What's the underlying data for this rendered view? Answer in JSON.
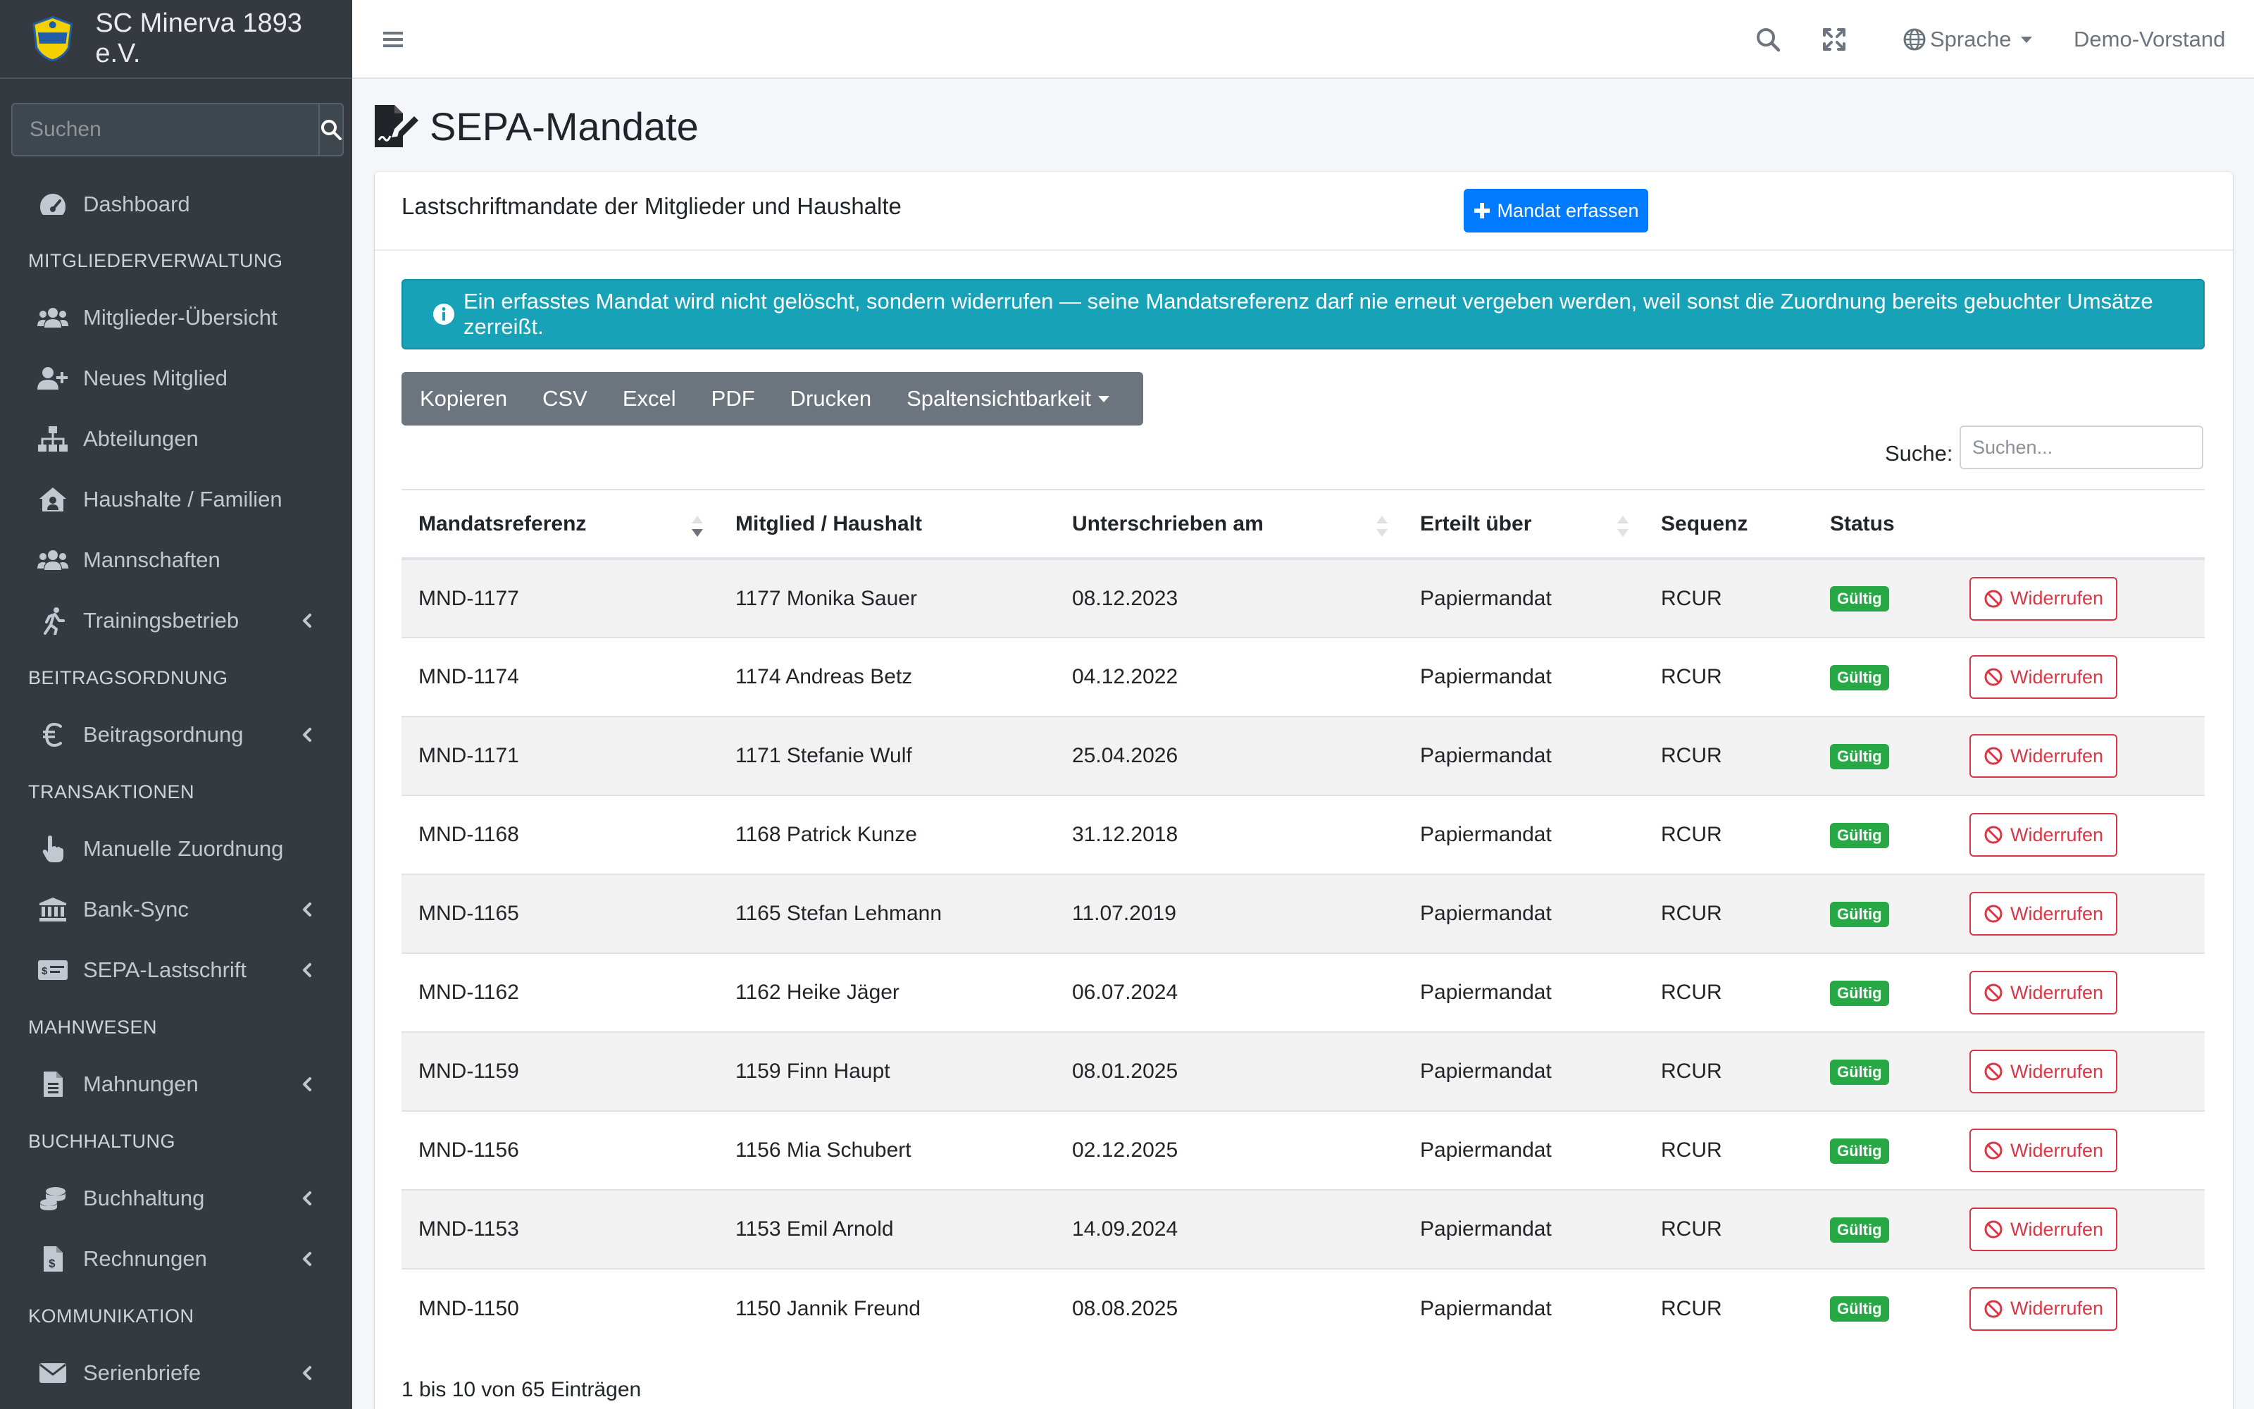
{
  "brand": {
    "name": "SC Minerva 1893 e.V."
  },
  "sidebar": {
    "search_placeholder": "Suchen",
    "dashboard": "Dashboard",
    "sections": [
      "MITGLIEDERVERWALTUNG",
      "BEITRAGSORDNUNG",
      "TRANSAKTIONEN",
      "MAHNWESEN",
      "BUCHHALTUNG",
      "KOMMUNIKATION"
    ],
    "items": {
      "mitglieder_uebersicht": "Mitglieder-Übersicht",
      "neues_mitglied": "Neues Mitglied",
      "abteilungen": "Abteilungen",
      "haushalte": "Haushalte / Familien",
      "mannschaften": "Mannschaften",
      "trainingsbetrieb": "Trainingsbetrieb",
      "beitragsordnung": "Beitragsordnung",
      "manuelle_zuordnung": "Manuelle Zuordnung",
      "bank_sync": "Bank-Sync",
      "sepa_lastschrift": "SEPA-Lastschrift",
      "mahnungen": "Mahnungen",
      "buchhaltung": "Buchhaltung",
      "rechnungen": "Rechnungen",
      "serienbriefe": "Serienbriefe"
    }
  },
  "topbar": {
    "language": "Sprache",
    "user": "Demo-Vorstand"
  },
  "page": {
    "title": "SEPA-Mandate"
  },
  "card": {
    "title": "Lastschriftmandate der Mitglieder und Haushalte",
    "add_button": "Mandat erfassen",
    "alert": "Ein erfasstes Mandat wird nicht gelöscht, sondern widerrufen — seine Mandatsreferenz darf nie erneut vergeben werden, weil sonst die Zuordnung bereits gebuchter Umsätze zerreißt.",
    "export_buttons": [
      "Kopieren",
      "CSV",
      "Excel",
      "PDF",
      "Drucken"
    ],
    "column_visibility": "Spaltensichtbarkeit",
    "search_label": "Suche:",
    "search_placeholder": "Suchen...",
    "columns": [
      "Mandatsreferenz",
      "Mitglied / Haushalt",
      "Unterschrieben am",
      "Erteilt über",
      "Sequenz",
      "Status"
    ],
    "rows": [
      {
        "ref": "MND-1177",
        "member": "1177 Monika Sauer",
        "signed": "08.12.2023",
        "via": "Papiermandat",
        "seq": "RCUR",
        "status": "Gültig",
        "action": "Widerrufen"
      },
      {
        "ref": "MND-1174",
        "member": "1174 Andreas Betz",
        "signed": "04.12.2022",
        "via": "Papiermandat",
        "seq": "RCUR",
        "status": "Gültig",
        "action": "Widerrufen"
      },
      {
        "ref": "MND-1171",
        "member": "1171 Stefanie Wulf",
        "signed": "25.04.2026",
        "via": "Papiermandat",
        "seq": "RCUR",
        "status": "Gültig",
        "action": "Widerrufen"
      },
      {
        "ref": "MND-1168",
        "member": "1168 Patrick Kunze",
        "signed": "31.12.2018",
        "via": "Papiermandat",
        "seq": "RCUR",
        "status": "Gültig",
        "action": "Widerrufen"
      },
      {
        "ref": "MND-1165",
        "member": "1165 Stefan Lehmann",
        "signed": "11.07.2019",
        "via": "Papiermandat",
        "seq": "RCUR",
        "status": "Gültig",
        "action": "Widerrufen"
      },
      {
        "ref": "MND-1162",
        "member": "1162 Heike Jäger",
        "signed": "06.07.2024",
        "via": "Papiermandat",
        "seq": "RCUR",
        "status": "Gültig",
        "action": "Widerrufen"
      },
      {
        "ref": "MND-1159",
        "member": "1159 Finn Haupt",
        "signed": "08.01.2025",
        "via": "Papiermandat",
        "seq": "RCUR",
        "status": "Gültig",
        "action": "Widerrufen"
      },
      {
        "ref": "MND-1156",
        "member": "1156 Mia Schubert",
        "signed": "02.12.2025",
        "via": "Papiermandat",
        "seq": "RCUR",
        "status": "Gültig",
        "action": "Widerrufen"
      },
      {
        "ref": "MND-1153",
        "member": "1153 Emil Arnold",
        "signed": "14.09.2024",
        "via": "Papiermandat",
        "seq": "RCUR",
        "status": "Gültig",
        "action": "Widerrufen"
      },
      {
        "ref": "MND-1150",
        "member": "1150 Jannik Freund",
        "signed": "08.08.2025",
        "via": "Papiermandat",
        "seq": "RCUR",
        "status": "Gültig",
        "action": "Widerrufen"
      }
    ],
    "info": "1 bis 10 von 65 Einträgen"
  },
  "colors": {
    "sidebar_bg": "#343a40",
    "primary": "#007bff",
    "info": "#17a2b8",
    "success": "#28a745",
    "danger": "#dc3545",
    "secondary": "#6c757d"
  }
}
